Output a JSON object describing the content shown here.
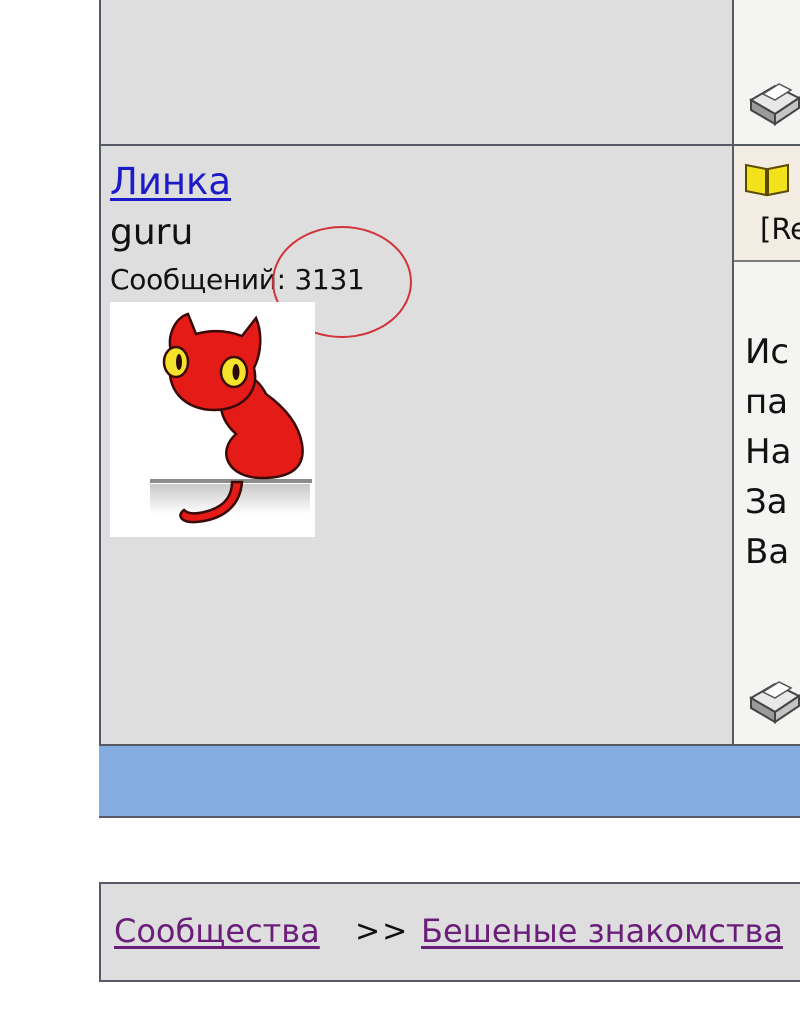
{
  "post": {
    "username": "Линка",
    "rank": "guru",
    "posts_label": "Сообщений: 3131",
    "reply_fragment": "[Re",
    "message_fragments": [
      "Ис",
      "па",
      "На",
      "За",
      "Ва"
    ]
  },
  "breadcrumb": {
    "items": [
      "Сообщества",
      "Бешеные знакомства"
    ],
    "separator": ">>"
  },
  "icons": {
    "avatar": "red-cat-avatar",
    "book": "book-icon",
    "printer": "printer-icon"
  },
  "colors": {
    "link": "#1d1ac8",
    "visited_link": "#6a1e7a",
    "table_background": "#dedede",
    "blue_band": "#86ade1",
    "highlight_circle": "#d2323a"
  }
}
